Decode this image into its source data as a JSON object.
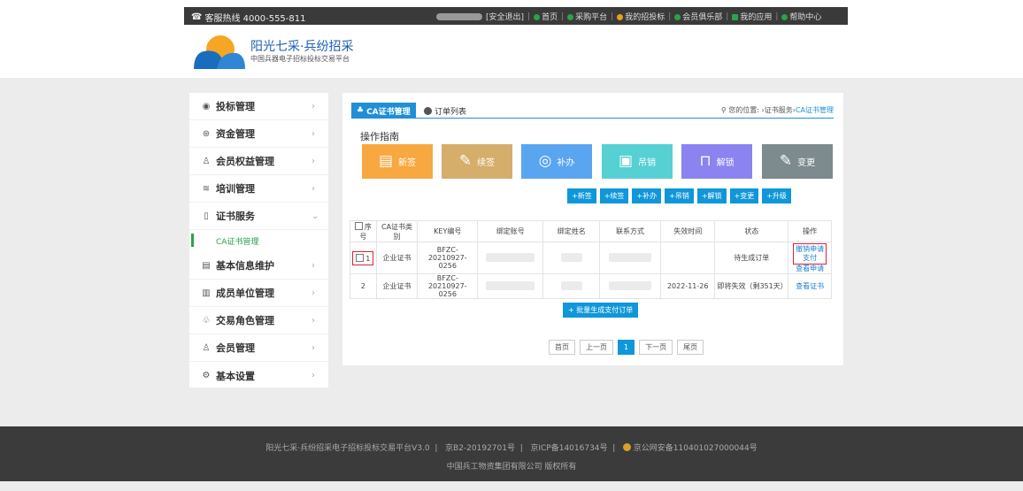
{
  "topbar": {
    "hotline": "客服热线 4000-555-811",
    "logout": "[安全退出]",
    "home": "首页",
    "purchase": "采购平台",
    "mybids": "我的招投标",
    "club": "会员俱乐部",
    "apps": "我的应用",
    "help": "帮助中心"
  },
  "header": {
    "title": "阳光七采·兵纷招采",
    "subtitle": "中国兵器电子招标投标交易平台"
  },
  "sidebar": {
    "items": [
      {
        "label": "投标管理",
        "icon": "bid-icon"
      },
      {
        "label": "资金管理",
        "icon": "yen-icon"
      },
      {
        "label": "会员权益管理",
        "icon": "member-icon"
      },
      {
        "label": "培训管理",
        "icon": "training-icon"
      },
      {
        "label": "证书服务",
        "icon": "certificate-icon"
      },
      {
        "label": "基本信息维护",
        "icon": "info-icon"
      },
      {
        "label": "成员单位管理",
        "icon": "unit-icon"
      },
      {
        "label": "交易角色管理",
        "icon": "role-icon"
      },
      {
        "label": "会员管理",
        "icon": "member-icon"
      },
      {
        "label": "基本设置",
        "icon": "gear-icon"
      }
    ],
    "subitem": "CA证书管理"
  },
  "main": {
    "tab_active": "CA证书管理",
    "tab_orders": "订单列表",
    "breadcrumb_prefix": "您的位置: ›证书服务›",
    "breadcrumb_current": "CA证书管理",
    "guide_title": "操作指南",
    "big_buttons": [
      {
        "label": "新签",
        "color": "#f7a840",
        "icon": "document-icon"
      },
      {
        "label": "续签",
        "color": "#d5ae6b",
        "icon": "edit-icon"
      },
      {
        "label": "补办",
        "color": "#5aa5f0",
        "icon": "reissue-icon"
      },
      {
        "label": "吊销",
        "color": "#56d0d2",
        "icon": "revoke-icon"
      },
      {
        "label": "解锁",
        "color": "#8b83f0",
        "icon": "unlock-icon"
      },
      {
        "label": "变更",
        "color": "#7d8a8e",
        "icon": "change-icon"
      }
    ],
    "small_buttons": [
      "+新签",
      "+续签",
      "+补办",
      "+吊销",
      "+解锁",
      "+变更",
      "+升级"
    ],
    "table": {
      "headers": [
        "序号",
        "CA证书类别",
        "KEY编号",
        "绑定账号",
        "绑定姓名",
        "联系方式",
        "失效时间",
        "状态",
        "操作"
      ],
      "rows": [
        {
          "num": "1",
          "category": "企业证书",
          "key_line1": "BFZC-20210927-",
          "key_line2": "0256",
          "expire": "",
          "status": "待生成订单",
          "actions": [
            "撤销申请",
            "支付",
            "查看申请"
          ]
        },
        {
          "num": "2",
          "category": "企业证书",
          "key_line1": "BFZC-20210927-",
          "key_line2": "0256",
          "expire": "2022-11-26",
          "status": "即将失效（剩351天）",
          "actions": [
            "查看证书"
          ]
        }
      ]
    },
    "batch_button": "+ 批量生成支付订单",
    "pager": {
      "first": "首页",
      "prev": "上一页",
      "current": "1",
      "next": "下一页",
      "last": "尾页"
    }
  },
  "footer": {
    "line1_a": "阳光七采·兵纷招采电子招标投标交易平台V3.0",
    "line1_b": "京B2-20192701号",
    "line1_c": "京ICP备14016734号",
    "line1_d": "京公网安备110401027000044号",
    "line2": "中国兵工物资集团有限公司 版权所有"
  }
}
